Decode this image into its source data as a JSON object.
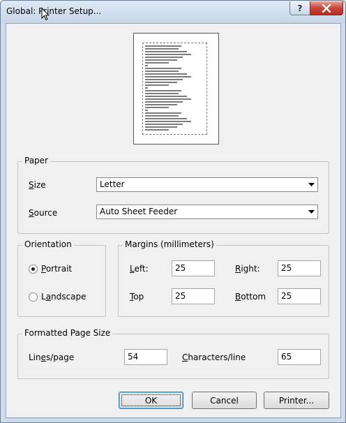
{
  "window": {
    "title": "Global: Printer Setup..."
  },
  "titlebar": {
    "help_label": "?"
  },
  "paper": {
    "legend": "Paper",
    "size_label": "Size",
    "size_value": "Letter",
    "source_label": "Source",
    "source_value": "Auto Sheet Feeder"
  },
  "orientation": {
    "legend": "Orientation",
    "portrait_label": "Portrait",
    "landscape_label": "Landscape",
    "selected": "Portrait"
  },
  "margins": {
    "legend": "Margins (millimeters)",
    "left_label": "Left:",
    "left_value": "25",
    "right_label": "Right:",
    "right_value": "25",
    "top_label": "Top",
    "top_value": "25",
    "bottom_label": "Bottom",
    "bottom_value": "25"
  },
  "formatted": {
    "legend": "Formatted Page Size",
    "lines_label": "Lines/page",
    "lines_value": "54",
    "chars_label": "Characters/line",
    "chars_value": "65"
  },
  "buttons": {
    "ok": "OK",
    "cancel": "Cancel",
    "printer": "Printer..."
  }
}
